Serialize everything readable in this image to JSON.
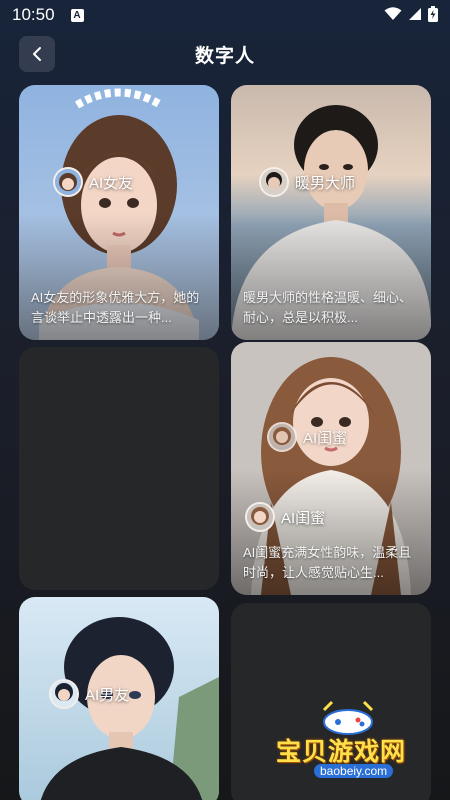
{
  "status_bar": {
    "time": "10:50",
    "notification_glyph": "A"
  },
  "header": {
    "title": "数字人"
  },
  "cards": [
    {
      "name": "AI女友",
      "description": "AI女友的形象优雅大方，她的言谈举止中透露出一种..."
    },
    {
      "name": "暖男大师",
      "description": "暖男大师的性格温暖、细心、耐心，总是以积极..."
    },
    {
      "name": "AI闺蜜",
      "description": "AI闺蜜充满女性韵味，温柔且时尚，让人感觉贴心生..."
    },
    {
      "name": "AI男友"
    }
  ],
  "watermark": {
    "text": "宝贝游戏网",
    "url": "baobeiy.com"
  },
  "colors": {
    "background": "#1b1f2b",
    "card_empty": "#262729",
    "watermark": "#ffe04a"
  }
}
